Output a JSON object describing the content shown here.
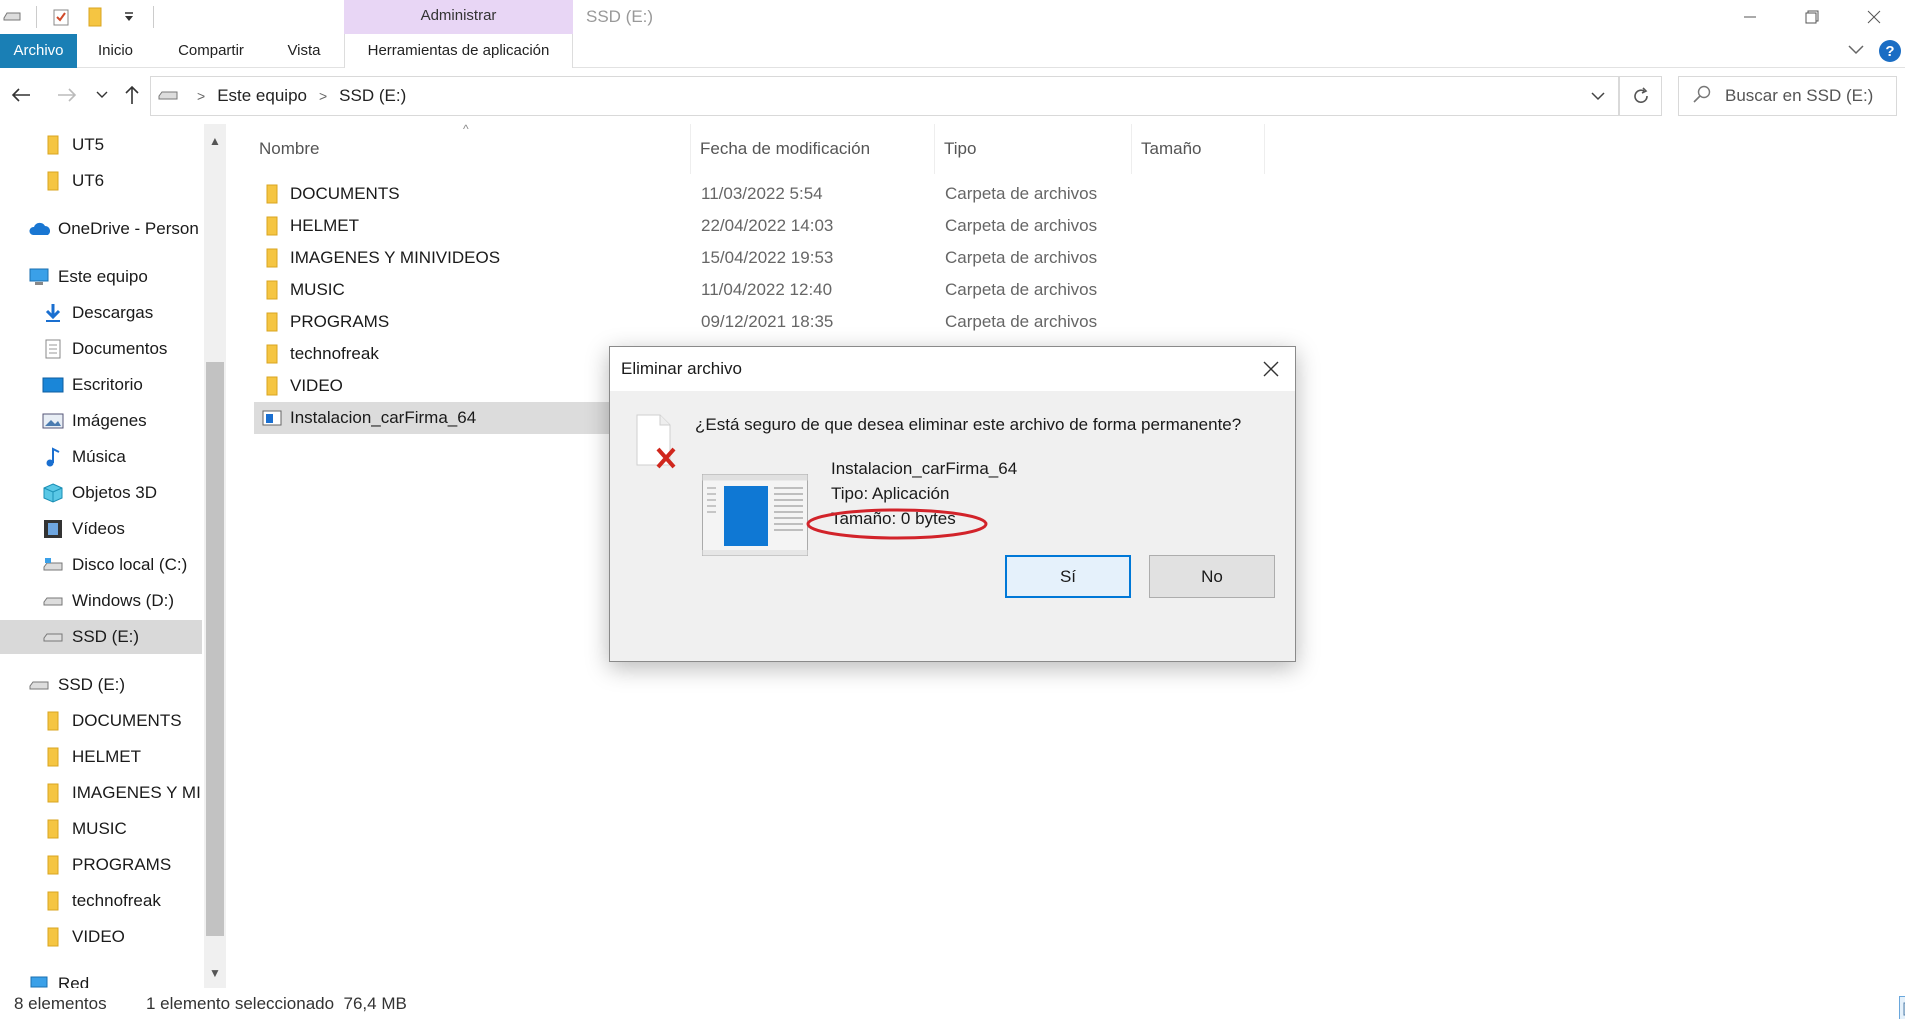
{
  "window": {
    "title": "SSD (E:)",
    "context_tab_header": "Administrar"
  },
  "ribbon": {
    "tabs": [
      {
        "label": "Archivo"
      },
      {
        "label": "Inicio"
      },
      {
        "label": "Compartir"
      },
      {
        "label": "Vista"
      },
      {
        "label": "Herramientas de aplicación"
      }
    ],
    "help_label": "?"
  },
  "address": {
    "crumbs": [
      "Este equipo",
      "SSD (E:)"
    ],
    "search_placeholder": "Buscar en SSD (E:)"
  },
  "nav": {
    "items": [
      {
        "label": "UT5",
        "icon": "folder-icon"
      },
      {
        "label": "UT6",
        "icon": "folder-icon"
      },
      {
        "label": "OneDrive - Person",
        "icon": "onedrive-icon"
      },
      {
        "label": "Este equipo",
        "icon": "computer-icon"
      },
      {
        "label": "Descargas",
        "icon": "download-icon"
      },
      {
        "label": "Documentos",
        "icon": "documents-icon"
      },
      {
        "label": "Escritorio",
        "icon": "desktop-icon"
      },
      {
        "label": "Imágenes",
        "icon": "pictures-icon"
      },
      {
        "label": "Música",
        "icon": "music-icon"
      },
      {
        "label": "Objetos 3D",
        "icon": "objects3d-icon"
      },
      {
        "label": "Vídeos",
        "icon": "videos-icon"
      },
      {
        "label": "Disco local (C:)",
        "icon": "drive-c-icon"
      },
      {
        "label": "Windows (D:)",
        "icon": "drive-icon"
      },
      {
        "label": "SSD (E:)",
        "icon": "drive-icon"
      },
      {
        "label": "SSD (E:)",
        "icon": "drive-icon"
      },
      {
        "label": "DOCUMENTS",
        "icon": "folder-icon"
      },
      {
        "label": "HELMET",
        "icon": "folder-icon"
      },
      {
        "label": "IMAGENES Y MINIVIDEOS",
        "icon": "folder-icon"
      },
      {
        "label": "MUSIC",
        "icon": "folder-icon"
      },
      {
        "label": "PROGRAMS",
        "icon": "folder-icon"
      },
      {
        "label": "technofreak",
        "icon": "folder-icon"
      },
      {
        "label": "VIDEO",
        "icon": "folder-icon"
      },
      {
        "label": "Red",
        "icon": "network-icon"
      }
    ]
  },
  "columns": {
    "name": "Nombre",
    "date": "Fecha de modificación",
    "type": "Tipo",
    "size": "Tamaño"
  },
  "files": [
    {
      "name": "DOCUMENTS",
      "date": "11/03/2022 5:54",
      "type": "Carpeta de archivos",
      "icon": "folder-icon"
    },
    {
      "name": "HELMET",
      "date": "22/04/2022 14:03",
      "type": "Carpeta de archivos",
      "icon": "folder-icon"
    },
    {
      "name": "IMAGENES Y MINIVIDEOS",
      "date": "15/04/2022 19:53",
      "type": "Carpeta de archivos",
      "icon": "folder-icon"
    },
    {
      "name": "MUSIC",
      "date": "11/04/2022 12:40",
      "type": "Carpeta de archivos",
      "icon": "folder-icon"
    },
    {
      "name": "PROGRAMS",
      "date": "09/12/2021 18:35",
      "type": "Carpeta de archivos",
      "icon": "folder-icon"
    },
    {
      "name": "technofreak",
      "date": "",
      "type": "",
      "icon": "folder-icon"
    },
    {
      "name": "VIDEO",
      "date": "",
      "type": "",
      "icon": "folder-icon"
    },
    {
      "name": "Instalacion_carFirma_64",
      "date": "",
      "type": "",
      "icon": "app-icon"
    }
  ],
  "status": {
    "count": "8 elementos",
    "selection": "1 elemento seleccionado  76,4 MB"
  },
  "dialog": {
    "title": "Eliminar archivo",
    "question": "¿Está seguro de que desea eliminar este archivo de forma permanente?",
    "file_name": "Instalacion_carFirma_64",
    "file_type": "Tipo: Aplicación",
    "file_size": "Tamaño: 0 bytes",
    "yes_label": "Sí",
    "no_label": "No",
    "highlight_color": "#d2232a"
  },
  "colors": {
    "folder": "#f5c542",
    "accent": "#0078d7",
    "file_tab": "#1a7fb5",
    "context_tab": "#e8d6f5"
  }
}
